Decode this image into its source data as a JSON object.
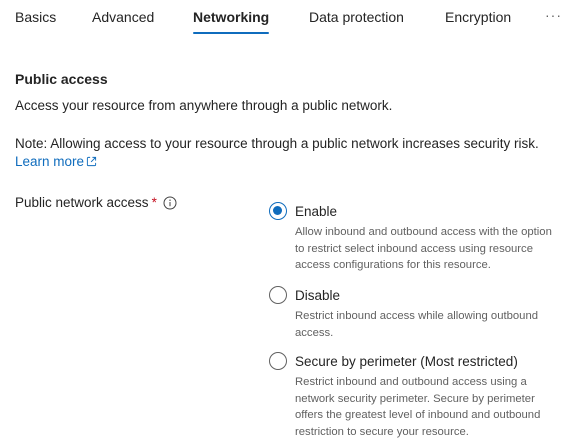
{
  "tabs": {
    "basics": "Basics",
    "advanced": "Advanced",
    "networking": "Networking",
    "data_protection": "Data protection",
    "encryption": "Encryption",
    "more": "···",
    "active": "Networking"
  },
  "section": {
    "title": "Public access",
    "description": "Access your resource from anywhere through a public network.",
    "note": "Note: Allowing access to your resource through a public network increases security risk. ",
    "learn_more": "Learn more"
  },
  "field": {
    "label": "Public network access",
    "required_marker": "*",
    "info_icon": "info-icon"
  },
  "options": [
    {
      "title": "Enable",
      "description": "Allow inbound and outbound access with the option to restrict select inbound access using resource access configurations for this resource.",
      "selected": true
    },
    {
      "title": "Disable",
      "description": "Restrict inbound access while allowing outbound access.",
      "selected": false
    },
    {
      "title": "Secure by perimeter (Most restricted)",
      "description": "Restrict inbound and outbound access using a network security perimeter. Secure by perimeter offers the greatest level of inbound and outbound restriction to secure your resource.",
      "selected": false
    }
  ],
  "colors": {
    "accent": "#0f6cbd",
    "required": "#c50f1f",
    "secondary_text": "#616161"
  }
}
